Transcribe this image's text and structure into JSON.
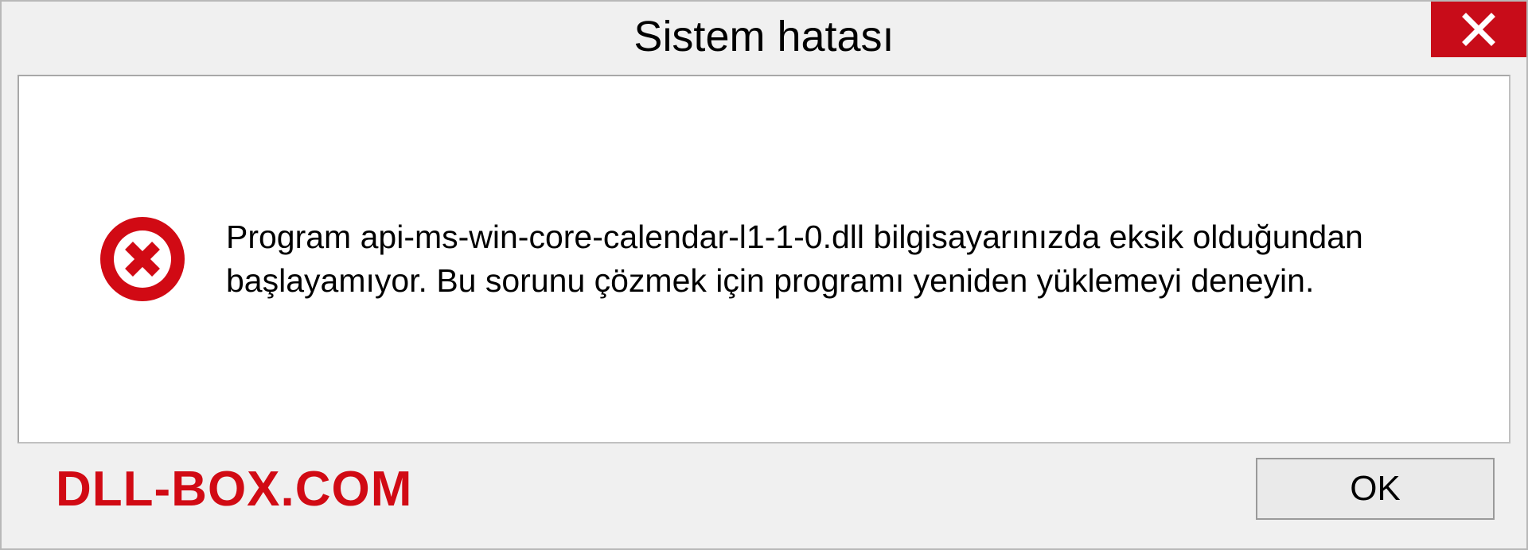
{
  "dialog": {
    "title": "Sistem hatası",
    "message": "Program api-ms-win-core-calendar-l1-1-0.dll bilgisayarınızda eksik olduğundan başlayamıyor. Bu sorunu çözmek için programı yeniden yüklemeyi deneyin.",
    "ok_label": "OK"
  },
  "watermark": "DLL-BOX.COM",
  "colors": {
    "close_bg": "#c80c19",
    "error_icon": "#d10a14",
    "watermark": "#d10a14"
  }
}
